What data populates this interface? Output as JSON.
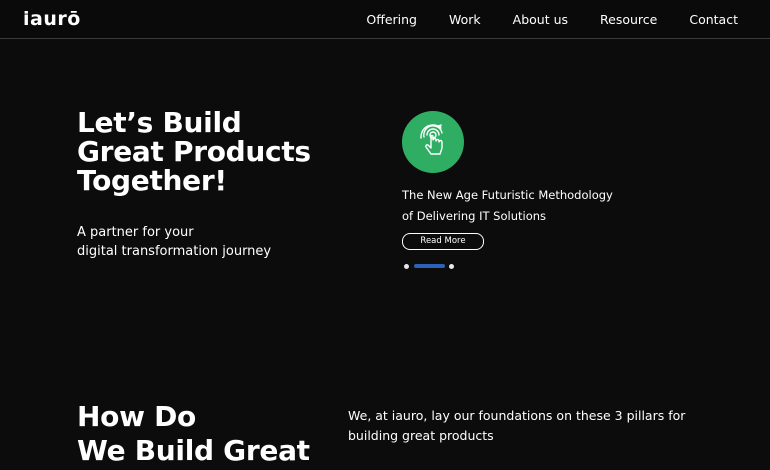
{
  "nav": {
    "logo": "iaurō",
    "links": [
      "Offering",
      "Work",
      "About us",
      "Resource",
      "Contact"
    ]
  },
  "hero": {
    "title_lines": [
      "Let’s Build",
      "Great Products",
      "Together!"
    ],
    "subtitle_lines": [
      "A partner for your",
      "digital transformation journey"
    ]
  },
  "slider": {
    "icon": "touch-hand-icon",
    "text_lines": [
      "The New Age Futuristic Methodology",
      "of Delivering IT Solutions"
    ],
    "button_label": "Read More",
    "active_slide": 2,
    "slide_count": 3,
    "icon_bg_color": "#2fae63",
    "indicator_color": "#2b62b8"
  },
  "section2": {
    "title_lines": [
      "How Do",
      "We Build Great"
    ],
    "text_lines": [
      "We, at iauro, lay our foundations on these 3 pillars for",
      "building great products"
    ]
  }
}
